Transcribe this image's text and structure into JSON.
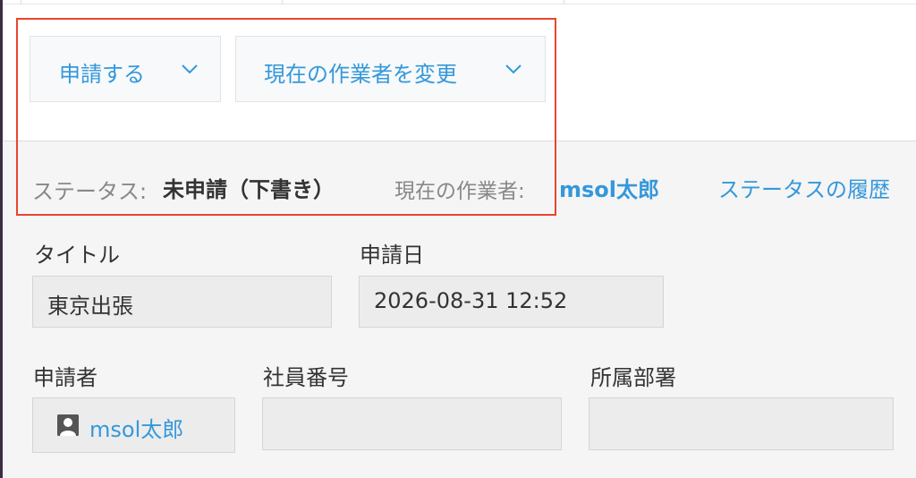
{
  "actions": {
    "apply_label": "申請する",
    "change_worker_label": "現在の作業者を変更"
  },
  "status": {
    "label": "ステータス:",
    "value": "未申請（下書き）",
    "worker_label": "現在の作業者:",
    "worker_name": "msol太郎",
    "history_link": "ステータスの履歴"
  },
  "fields": {
    "title_label": "タイトル",
    "title_value": "東京出張",
    "date_label": "申請日",
    "date_value": "2026-08-31 12:52",
    "applicant_label": "申請者",
    "applicant_name": "msol太郎",
    "employee_no_label": "社員番号",
    "employee_no_value": "",
    "department_label": "所属部署",
    "department_value": ""
  },
  "colors": {
    "accent": "#3498db",
    "highlight": "#e8452f"
  }
}
